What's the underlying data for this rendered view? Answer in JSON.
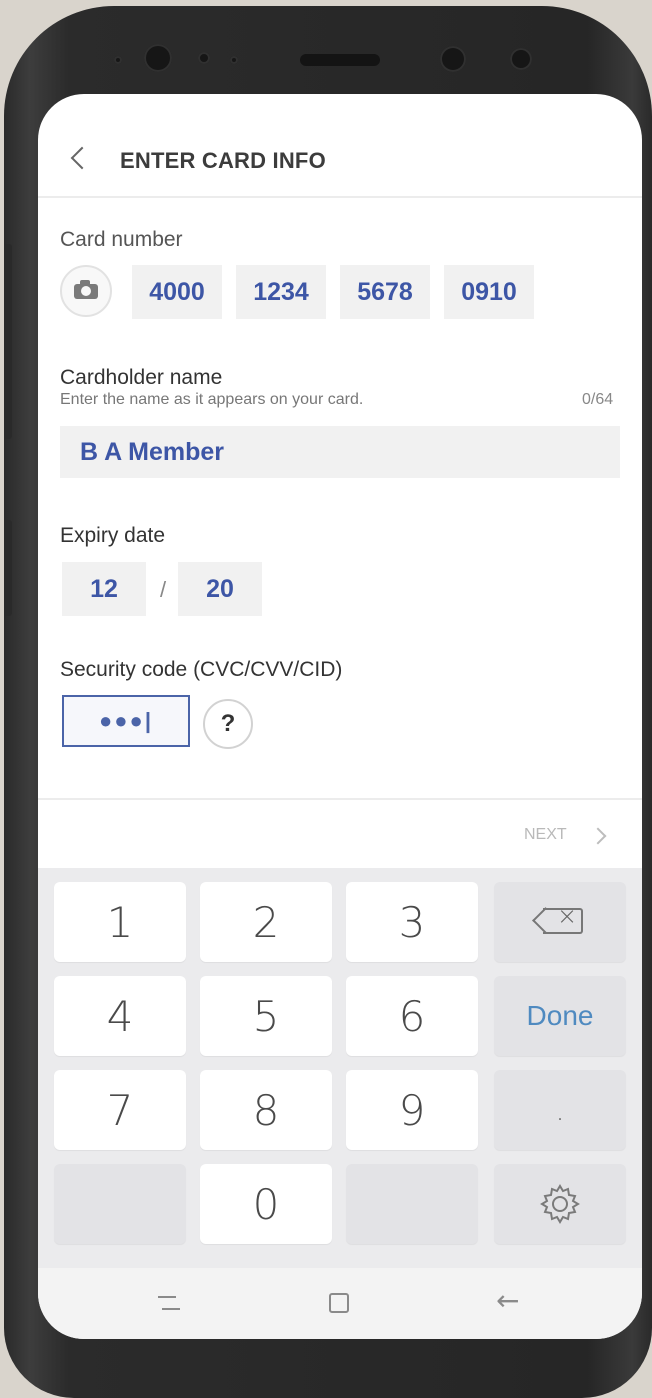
{
  "header": {
    "title": "ENTER CARD INFO"
  },
  "card_number": {
    "label": "Card number",
    "groups": [
      "4000",
      "1234",
      "5678",
      "0910"
    ]
  },
  "cardholder": {
    "label": "Cardholder name",
    "hint": "Enter the name as it appears on your card.",
    "counter": "0/64",
    "value": "B A Member"
  },
  "expiry": {
    "label": "Expiry date",
    "month": "12",
    "separator": "/",
    "year": "20"
  },
  "security": {
    "label": "Security code (CVC/CVV/CID)",
    "masked_value": "●●●|",
    "help": "?"
  },
  "next_label": "NEXT",
  "keypad": {
    "keys": [
      "1",
      "2",
      "3",
      "4",
      "5",
      "6",
      "7",
      "8",
      "9",
      "0"
    ],
    "done": "Done",
    "decimal": ".",
    "backspace_icon": "backspace-icon",
    "settings_icon": "gear-icon"
  },
  "colors": {
    "accent": "#3d56a6",
    "done": "#4f8ac0",
    "field_bg": "#f1f1f1"
  }
}
